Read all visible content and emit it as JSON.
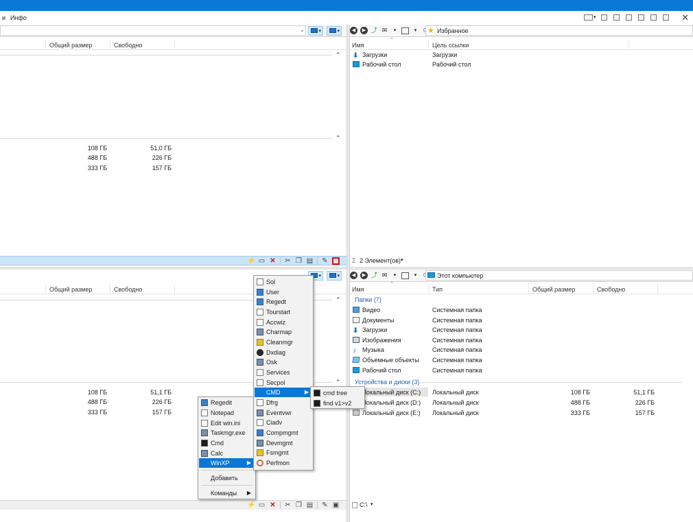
{
  "menubar": {
    "items": [
      "и",
      "Инфо"
    ]
  },
  "tl": {
    "columns": [
      "Общий размер",
      "Свободно"
    ],
    "rows": [
      {
        "total": "108 ГБ",
        "free": "51,0 ГБ"
      },
      {
        "total": "488 ГБ",
        "free": "226 ГБ"
      },
      {
        "total": "333 ГБ",
        "free": "157 ГБ"
      }
    ]
  },
  "tr": {
    "path": "Избранное",
    "columns": [
      "Имя",
      "Цель ссылки"
    ],
    "rows": [
      {
        "name": "Загрузки",
        "target": "Загрузки",
        "icon": "download-icon"
      },
      {
        "name": "Рабочий стол",
        "target": "Рабочий стол",
        "icon": "desktop-icon"
      }
    ],
    "status": "2 Элемент(ов)"
  },
  "bl": {
    "columns": [
      "Общий размер",
      "Свободно"
    ],
    "rows": [
      {
        "total": "108 ГБ",
        "free": "51,1 ГБ"
      },
      {
        "total": "488 ГБ",
        "free": "226 ГБ"
      },
      {
        "total": "333 ГБ",
        "free": "157 ГБ"
      }
    ]
  },
  "br": {
    "path": "Этот компьютер",
    "columns": [
      "Имя",
      "Тип",
      "Общий размер",
      "Свободно"
    ],
    "group_folders": "Папки (7)",
    "folders": [
      {
        "name": "Видео",
        "type": "Системная папка",
        "icon": "video-folder-icon"
      },
      {
        "name": "Документы",
        "type": "Системная папка",
        "icon": "documents-folder-icon"
      },
      {
        "name": "Загрузки",
        "type": "Системная папка",
        "icon": "download-icon"
      },
      {
        "name": "Изображения",
        "type": "Системная папка",
        "icon": "pictures-folder-icon"
      },
      {
        "name": "Музыка",
        "type": "Системная папка",
        "icon": "music-folder-icon"
      },
      {
        "name": "Объемные объекты",
        "type": "Системная папка",
        "icon": "3d-objects-icon"
      },
      {
        "name": "Рабочий стол",
        "type": "Системная папка",
        "icon": "desktop-icon"
      }
    ],
    "group_drives": "Устройства и диски (3)",
    "drives": [
      {
        "name": "Локальный диск (C:)",
        "type": "Локальный диск",
        "total": "108 ГБ",
        "free": "51,1 ГБ"
      },
      {
        "name": "Локальный диск (D:)",
        "type": "Локальный диск",
        "total": "488 ГБ",
        "free": "226 ГБ"
      },
      {
        "name": "Локальный диск (E:)",
        "type": "Локальный диск",
        "total": "333 ГБ",
        "free": "157 ГБ"
      }
    ],
    "status": "C:\\"
  },
  "menu_main": {
    "items": [
      {
        "label": "Regedit",
        "icon": "regedit-icon"
      },
      {
        "label": "Notepad",
        "icon": "notepad-icon"
      },
      {
        "label": "Edit win.ini",
        "icon": "edit-ini-icon"
      },
      {
        "label": "Taskmgr.exe",
        "icon": "taskmgr-icon"
      },
      {
        "label": "Cmd",
        "icon": "cmd-icon"
      },
      {
        "label": "Calc",
        "icon": "calc-icon"
      },
      {
        "label": "WinXP",
        "icon": "",
        "selected": true,
        "submenu": true
      }
    ],
    "add_label": "Добавить",
    "commands_label": "Команды"
  },
  "menu_winxp": {
    "items": [
      {
        "label": "Sol",
        "icon": "sol-icon"
      },
      {
        "label": "User",
        "icon": "user-icon"
      },
      {
        "label": "Regedt",
        "icon": "regedt-icon"
      },
      {
        "label": "Tourstart",
        "icon": "tourstart-icon"
      },
      {
        "label": "Accwiz",
        "icon": "accwiz-icon"
      },
      {
        "label": "Charmap",
        "icon": "charmap-icon"
      },
      {
        "label": "Cleanmgr",
        "icon": "cleanmgr-icon"
      },
      {
        "label": "Dxdiag",
        "icon": "dxdiag-icon"
      },
      {
        "label": "Osk",
        "icon": "osk-icon"
      },
      {
        "label": "Services",
        "icon": "services-icon"
      },
      {
        "label": "Secpol",
        "icon": "secpol-icon"
      },
      {
        "label": "CMD",
        "icon": "",
        "selected": true,
        "submenu": true
      },
      {
        "label": "Dfrg",
        "icon": "dfrg-icon"
      },
      {
        "label": "Eventvwr",
        "icon": "eventvwr-icon"
      },
      {
        "label": "Ciadv",
        "icon": "ciadv-icon"
      },
      {
        "label": "Compmgmt",
        "icon": "compmgmt-icon"
      },
      {
        "label": "Devmgmt",
        "icon": "devmgmt-icon"
      },
      {
        "label": "Fsmgmt",
        "icon": "fsmgmt-icon"
      },
      {
        "label": "Perfmon",
        "icon": "perfmon-icon"
      }
    ]
  },
  "menu_cmd": {
    "items": [
      {
        "label": "cmd tree",
        "icon": "cmd-icon"
      },
      {
        "label": "find v1>v2",
        "icon": "cmd-icon"
      }
    ]
  },
  "colors": {
    "accent": "#0a78d7",
    "selection": "#cce4f7",
    "group_label": "#1f5fb2",
    "close_red": "#d11414"
  }
}
